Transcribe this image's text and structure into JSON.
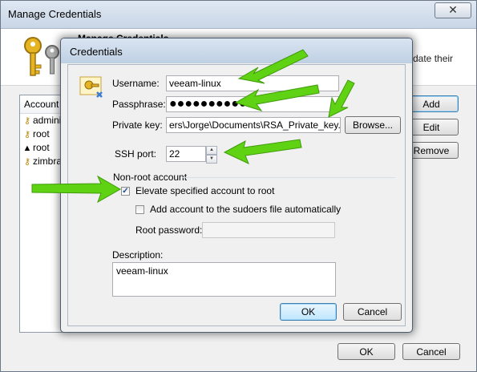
{
  "outer_window": {
    "title": "Manage Credentials",
    "close_symbol": "✕",
    "heading": "Manage Credentials",
    "description_fragment": "date their",
    "account_column_header": "Account",
    "accounts": [
      {
        "name": "adminis",
        "icon": "key-icon"
      },
      {
        "name": "root",
        "icon": "key-icon"
      },
      {
        "name": "root",
        "icon": "penguin-icon"
      },
      {
        "name": "zimbra",
        "icon": "key-icon"
      }
    ],
    "buttons": {
      "add": "Add",
      "edit": "Edit",
      "remove": "Remove",
      "ok": "OK",
      "cancel": "Cancel"
    }
  },
  "dialog": {
    "title": "Credentials",
    "labels": {
      "username": "Username:",
      "passphrase": "Passphrase:",
      "private_key": "Private key:",
      "ssh_port": "SSH port:",
      "non_root_group": "Non-root account",
      "elevate": "Elevate specified account to root",
      "sudoers": "Add account to the sudoers file automatically",
      "root_password": "Root password:",
      "description": "Description:"
    },
    "values": {
      "username": "veeam-linux",
      "passphrase": "●●●●●●●●●●●",
      "private_key": "ers\\Jorge\\Documents\\RSA_Private_key.ppk",
      "ssh_port": "22",
      "root_password": "",
      "description": "veeam-linux"
    },
    "checkboxes": {
      "elevate": true,
      "sudoers": false
    },
    "buttons": {
      "browse": "Browse...",
      "ok": "OK",
      "cancel": "Cancel"
    }
  },
  "annotation_color": "#5fd313"
}
